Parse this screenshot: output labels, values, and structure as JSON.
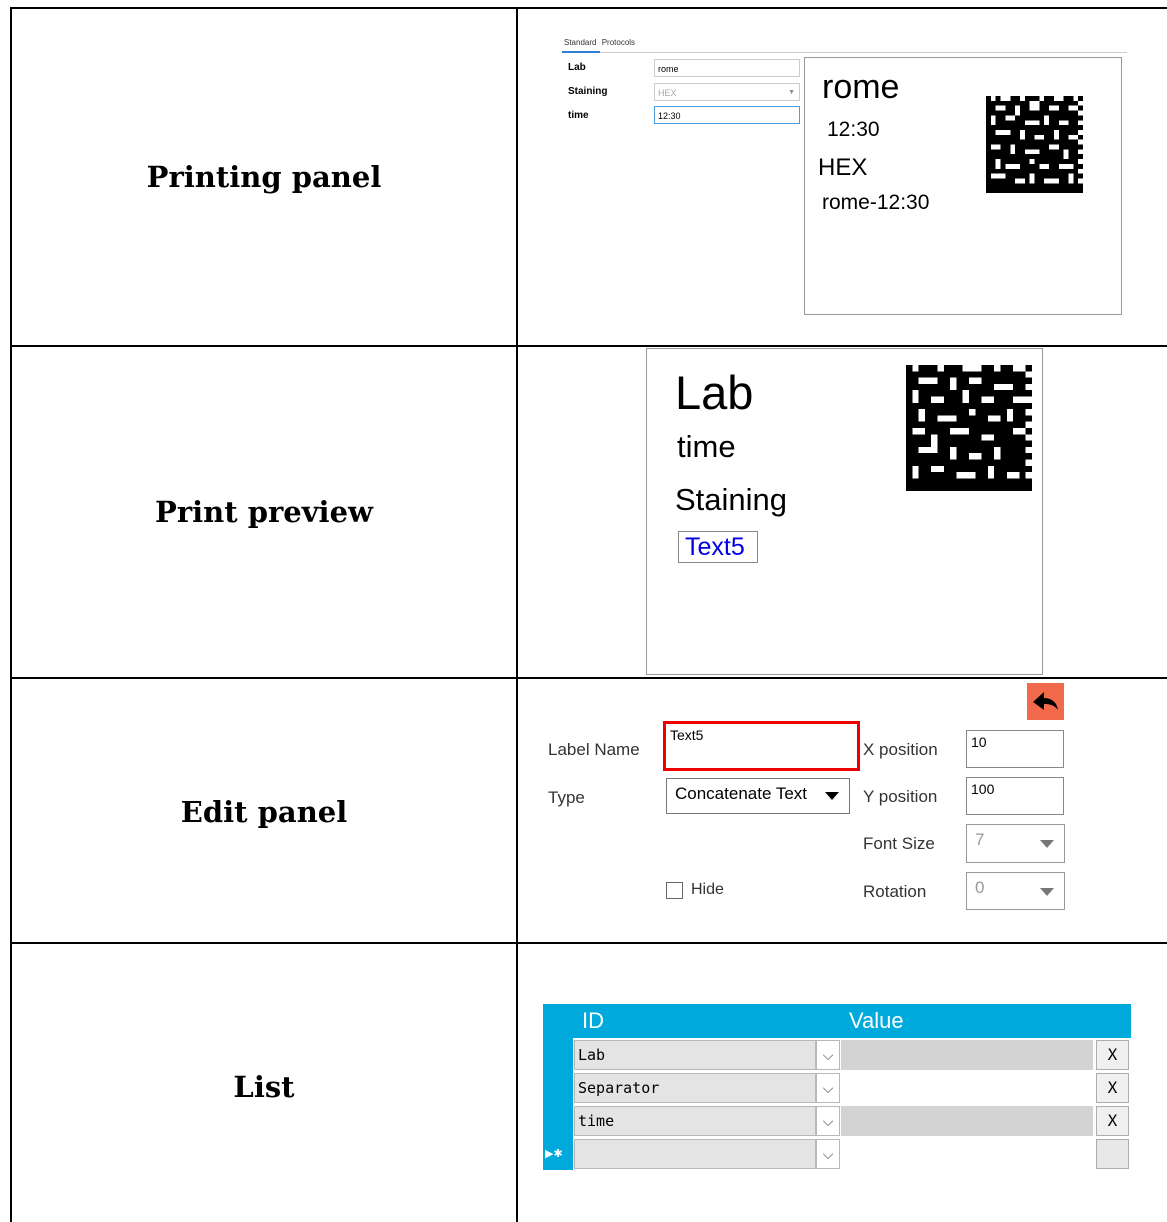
{
  "rows": {
    "printing_panel": "Printing panel",
    "print_preview": "Print preview",
    "edit_panel": "Edit panel",
    "list": "List"
  },
  "printing_panel": {
    "tabs": [
      "Standard",
      "Protocols"
    ],
    "fields": [
      {
        "label": "Lab",
        "value": "rome"
      },
      {
        "label": "Staining",
        "value": "HEX"
      },
      {
        "label": "time",
        "value": "12:30"
      }
    ],
    "preview": {
      "line1": "rome",
      "line2": "12:30",
      "line3": "HEX",
      "line4": "rome-12:30"
    }
  },
  "print_preview": {
    "line1": "Lab",
    "line2": "time",
    "line3": "Staining",
    "selected": "Text5"
  },
  "edit_panel": {
    "label_name_label": "Label Name",
    "label_name_value": "Text5",
    "type_label": "Type",
    "type_value": "Concatenate Text",
    "x_label": "X position",
    "x_value": "10",
    "y_label": "Y position",
    "y_value": "100",
    "font_size_label": "Font Size",
    "font_size_value": "7",
    "rotation_label": "Rotation",
    "rotation_value": "0",
    "hide_label": "Hide",
    "colors": {
      "back_button": "#f26a4b",
      "highlight": "#e00000"
    }
  },
  "list": {
    "headers": {
      "id": "ID",
      "value": "Value"
    },
    "rows": [
      {
        "id": "Lab",
        "remove": "X"
      },
      {
        "id": "Separator",
        "remove": "X"
      },
      {
        "id": "time",
        "remove": "X"
      },
      {
        "id": "",
        "remove": ""
      }
    ],
    "colors": {
      "header": "#00a9dc"
    }
  }
}
